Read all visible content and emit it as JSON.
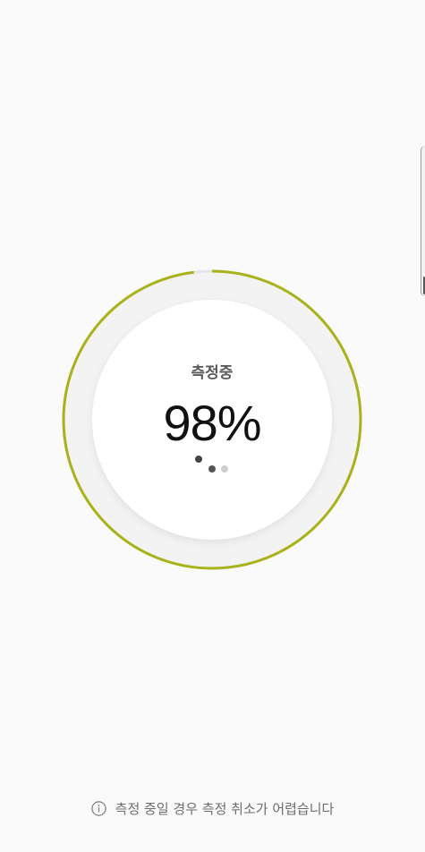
{
  "measurement": {
    "status_label": "측정중",
    "progress_percent": 98,
    "progress_text": "98%",
    "ring_color": "#a8b21a",
    "ring_track_color": "#e6e6e6"
  },
  "footer": {
    "info_icon": "info-icon",
    "note_text": "측정 중일 경우 측정 취소가 어렵습니다"
  }
}
